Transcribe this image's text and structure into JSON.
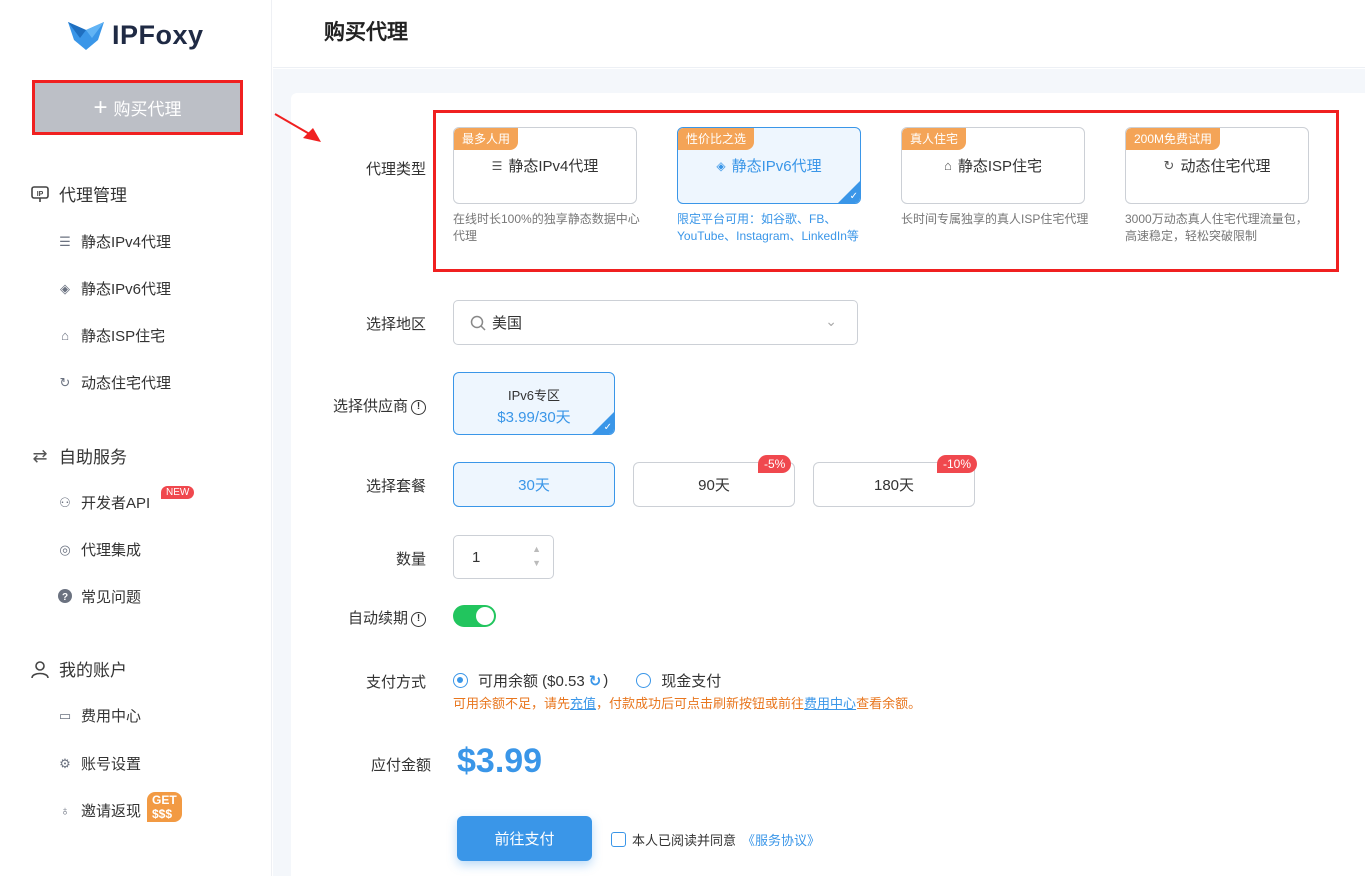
{
  "brand": {
    "name": "IPFoxy",
    "accent": "#3a96e8"
  },
  "sidebar": {
    "buy_button": "购买代理",
    "groups": [
      {
        "label": "代理管理",
        "icon": "ip-monitor-icon",
        "items": [
          {
            "label": "静态IPv4代理",
            "icon": "server-icon"
          },
          {
            "label": "静态IPv6代理",
            "icon": "layers-icon"
          },
          {
            "label": "静态ISP住宅",
            "icon": "home-icon"
          },
          {
            "label": "动态住宅代理",
            "icon": "cycle-icon"
          }
        ]
      },
      {
        "label": "自助服务",
        "icon": "route-icon",
        "items": [
          {
            "label": "开发者API",
            "icon": "webhook-icon",
            "badge": "NEW"
          },
          {
            "label": "代理集成",
            "icon": "fingerprint-icon"
          },
          {
            "label": "常见问题",
            "icon": "question-icon"
          }
        ]
      },
      {
        "label": "我的账户",
        "icon": "user-icon",
        "items": [
          {
            "label": "费用中心",
            "icon": "card-icon"
          },
          {
            "label": "账号设置",
            "icon": "gear-icon"
          },
          {
            "label": "邀请返现",
            "icon": "money-bag-icon",
            "badge": "GET $$$"
          }
        ]
      }
    ]
  },
  "header": {
    "title": "购买代理"
  },
  "form": {
    "type_label": "代理类型",
    "types": [
      {
        "tag": "最多人用",
        "name": "静态IPv4代理",
        "icon": "server-icon",
        "desc": "在线时长100%的独享静态数据中心代理",
        "selected": false
      },
      {
        "tag": "性价比之选",
        "name": "静态IPv6代理",
        "icon": "layers-icon",
        "desc": "限定平台可用：如谷歌、FB、YouTube、Instagram、LinkedIn等",
        "selected": true
      },
      {
        "tag": "真人住宅",
        "name": "静态ISP住宅",
        "icon": "home-icon",
        "desc": "长时间专属独享的真人ISP住宅代理",
        "selected": false
      },
      {
        "tag": "200M免费试用",
        "name": "动态住宅代理",
        "icon": "cycle-icon",
        "desc": "3000万动态真人住宅代理流量包，高速稳定，轻松突破限制",
        "selected": false
      }
    ],
    "region_label": "选择地区",
    "region_value": "美国",
    "supplier_label": "选择供应商",
    "supplier": {
      "name": "IPv6专区",
      "price": "$3.99/30天"
    },
    "plan_label": "选择套餐",
    "plans": [
      {
        "label": "30天",
        "selected": true,
        "discount": ""
      },
      {
        "label": "90天",
        "selected": false,
        "discount": "-5%"
      },
      {
        "label": "180天",
        "selected": false,
        "discount": "-10%"
      }
    ],
    "qty_label": "数量",
    "qty_value": "1",
    "renew_label": "自动续期",
    "renew_on": true,
    "pay_label": "支付方式",
    "pay_balance": "可用余额 ($0.53",
    "pay_balance_end": ")",
    "pay_cash": "现金支付",
    "note_pre": "可用余额不足，请先",
    "note_link1": "充值",
    "note_mid": "，付款成功后可点击刷新按钮或前往",
    "note_link2": "费用中心",
    "note_post": "查看余额。",
    "amount_label": "应付金额",
    "amount": "$3.99",
    "submit": "前往支付",
    "agree_text": "本人已阅读并同意",
    "agree_link": "《服务协议》"
  }
}
